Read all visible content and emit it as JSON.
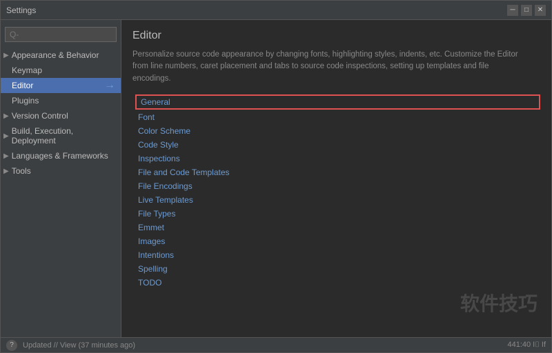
{
  "window": {
    "title": "Settings",
    "close_btn": "✕",
    "min_btn": "─",
    "max_btn": "□"
  },
  "sidebar": {
    "search_placeholder": "Q-",
    "items": [
      {
        "label": "Appearance & Behavior",
        "arrow": "▶",
        "expanded": false,
        "selected": false
      },
      {
        "label": "Keymap",
        "arrow": "",
        "expanded": false,
        "selected": false
      },
      {
        "label": "Editor",
        "arrow": "",
        "expanded": true,
        "selected": true
      },
      {
        "label": "Plugins",
        "arrow": "",
        "expanded": false,
        "selected": false
      },
      {
        "label": "Version Control",
        "arrow": "▶",
        "expanded": false,
        "selected": false
      },
      {
        "label": "Build, Execution, Deployment",
        "arrow": "▶",
        "expanded": false,
        "selected": false
      },
      {
        "label": "Languages & Frameworks",
        "arrow": "▶",
        "expanded": false,
        "selected": false
      },
      {
        "label": "Tools",
        "arrow": "▶",
        "expanded": false,
        "selected": false
      }
    ]
  },
  "main": {
    "title": "Editor",
    "description": "Personalize source code appearance by changing fonts, highlighting styles, indents, etc. Customize the Editor from line numbers, caret placement and tabs to source code inspections, setting up templates and file encodings.",
    "sub_items": [
      {
        "label": "General",
        "highlighted": true
      },
      {
        "label": "Font",
        "highlighted": false
      },
      {
        "label": "Color Scheme",
        "highlighted": false
      },
      {
        "label": "Code Style",
        "highlighted": false
      },
      {
        "label": "Inspections",
        "highlighted": false
      },
      {
        "label": "File and Code Templates",
        "highlighted": false
      },
      {
        "label": "File Encodings",
        "highlighted": false
      },
      {
        "label": "Live Templates",
        "highlighted": false
      },
      {
        "label": "File Types",
        "highlighted": false
      },
      {
        "label": "Emmet",
        "highlighted": false
      },
      {
        "label": "Images",
        "highlighted": false
      },
      {
        "label": "Intentions",
        "highlighted": false
      },
      {
        "label": "Spelling",
        "highlighted": false
      },
      {
        "label": "TODO",
        "highlighted": false
      }
    ]
  },
  "watermark": "软件技巧",
  "status_bar": {
    "left_text": "Updated // View (37 minutes ago)",
    "right_text": "441:40  I⌷  If"
  }
}
